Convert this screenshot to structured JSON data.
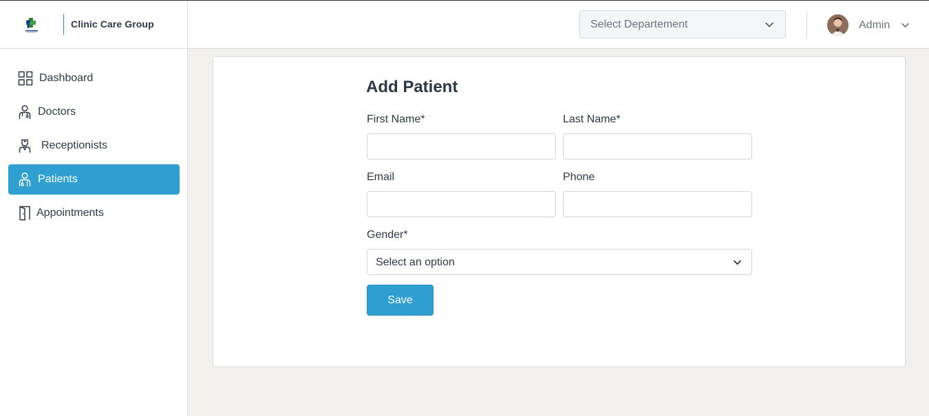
{
  "header": {
    "brand_name": "Clinic Care Group",
    "department_select": {
      "value": "Select Departement"
    },
    "user": {
      "name": "Admin"
    }
  },
  "sidebar": {
    "items": [
      {
        "label": "Dashboard",
        "icon": "dashboard-grid-icon",
        "active": false
      },
      {
        "label": "Doctors",
        "icon": "doctor-icon",
        "active": false
      },
      {
        "label": "Receptionists",
        "icon": "receptionist-icon",
        "active": false
      },
      {
        "label": "Patients",
        "icon": "patient-icon",
        "active": true
      },
      {
        "label": "Appointments",
        "icon": "door-icon",
        "active": false
      }
    ]
  },
  "form": {
    "title": "Add Patient",
    "first_name": {
      "label": "First Name*",
      "value": ""
    },
    "last_name": {
      "label": "Last Name*",
      "value": ""
    },
    "email": {
      "label": "Email",
      "value": ""
    },
    "phone": {
      "label": "Phone",
      "value": ""
    },
    "gender": {
      "label": "Gender*",
      "value": "Select an option"
    },
    "save_label": "Save"
  },
  "colors": {
    "accent": "#2e9fd0",
    "text": "#2d3748",
    "page_bg": "#f1f0ed"
  }
}
